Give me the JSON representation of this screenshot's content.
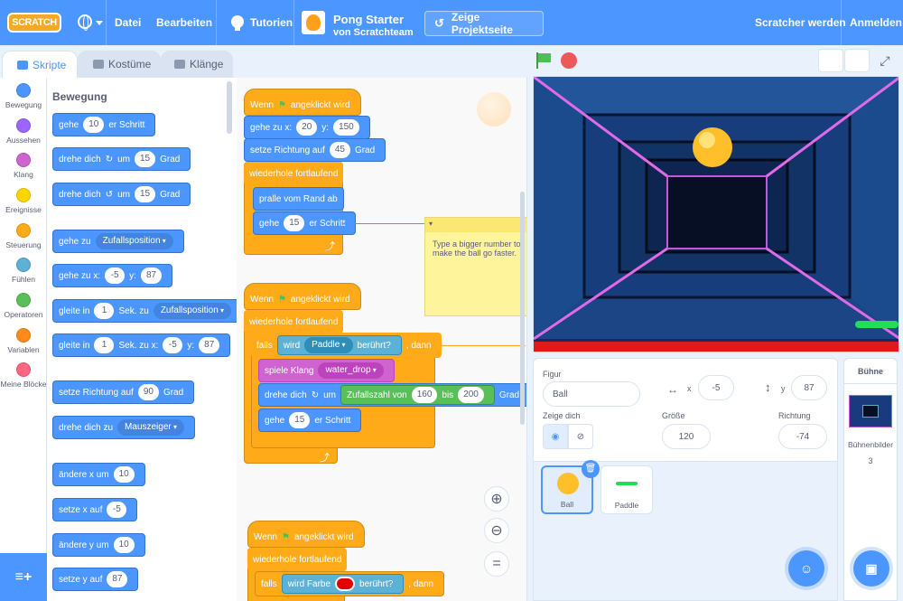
{
  "menubar": {
    "logo": "SCRATCH",
    "file": "Datei",
    "edit": "Bearbeiten",
    "tutorials": "Tutorien",
    "project_title": "Pong Starter",
    "project_by_prefix": "von",
    "project_author": "Scratchteam",
    "project_page": "Zeige Projektseite",
    "join": "Scratcher werden",
    "signin": "Anmelden"
  },
  "tabs": {
    "code": "Skripte",
    "costumes": "Kostüme",
    "sounds": "Klänge"
  },
  "categories": [
    {
      "label": "Bewegung",
      "color": "#4c97ff"
    },
    {
      "label": "Aussehen",
      "color": "#9966ff"
    },
    {
      "label": "Klang",
      "color": "#cf63cf"
    },
    {
      "label": "Ereignisse",
      "color": "#ffd500"
    },
    {
      "label": "Steuerung",
      "color": "#ffab19"
    },
    {
      "label": "Fühlen",
      "color": "#5cb1d6"
    },
    {
      "label": "Operatoren",
      "color": "#59c059"
    },
    {
      "label": "Variablen",
      "color": "#ff8c1a"
    },
    {
      "label": "Meine Blöcke",
      "color": "#ff6680"
    }
  ],
  "palette": {
    "title": "Bewegung",
    "move": {
      "a": "gehe",
      "v": "10",
      "b": "er Schritt"
    },
    "turn_right": {
      "a": "drehe dich",
      "b": "um",
      "v": "15",
      "c": "Grad"
    },
    "turn_left": {
      "a": "drehe dich",
      "b": "um",
      "v": "15",
      "c": "Grad"
    },
    "goto": {
      "a": "gehe zu",
      "d": "Zufallsposition"
    },
    "goto_xy": {
      "a": "gehe zu x:",
      "x": "-5",
      "b": "y:",
      "y": "87"
    },
    "glide": {
      "a": "gleite in",
      "v": "1",
      "b": "Sek. zu",
      "d": "Zufallsposition"
    },
    "glide_xy": {
      "a": "gleite in",
      "v": "1",
      "b": "Sek. zu x:",
      "x": "-5",
      "c": "y:",
      "y": "87"
    },
    "point_dir": {
      "a": "setze Richtung auf",
      "v": "90",
      "b": "Grad"
    },
    "point_towards": {
      "a": "drehe dich zu",
      "d": "Mauszeiger"
    },
    "change_x": {
      "a": "ändere x um",
      "v": "10"
    },
    "set_x": {
      "a": "setze x auf",
      "v": "-5"
    },
    "change_y": {
      "a": "ändere y um",
      "v": "10"
    },
    "set_y": {
      "a": "setze y auf",
      "v": "87"
    }
  },
  "script1": {
    "hat": "Wenn",
    "hat2": "angeklickt wird",
    "goto_a": "gehe zu x:",
    "x": "20",
    "goto_b": "y:",
    "y": "150",
    "dir_a": "setze Richtung auf",
    "dir_v": "45",
    "dir_b": "Grad",
    "forever": "wiederhole fortlaufend",
    "bounce": "pralle vom Rand ab",
    "move_a": "gehe",
    "move_v": "15",
    "move_b": "er Schritt"
  },
  "note": "Type a bigger number to make the ball go faster.",
  "script2": {
    "hat": "Wenn",
    "hat2": "angeklickt wird",
    "forever": "wiederhole fortlaufend",
    "if_a": "falls",
    "touch_a": "wird",
    "touch_d": "Paddle",
    "touch_b": "berührt?",
    "if_b": ", dann",
    "sound_a": "spiele Klang",
    "sound_d": "water_drop",
    "turn_a": "drehe dich",
    "turn_b": "um",
    "rand_a": "Zufallszahl von",
    "rand_v1": "160",
    "rand_b": "bis",
    "rand_v2": "200",
    "turn_c": "Grad",
    "move_a": "gehe",
    "move_v": "15",
    "move_b": "er Schritt"
  },
  "script3": {
    "hat": "Wenn",
    "hat2": "angeklickt wird",
    "forever": "wiederhole fortlaufend",
    "if_a": "falls",
    "color_a": "wird Farbe",
    "color_b": "berührt?",
    "if_b": ", dann"
  },
  "sprite_info": {
    "sprite_label": "Figur",
    "sprite_name": "Ball",
    "x_label": "x",
    "x": "-5",
    "y_label": "y",
    "y": "87",
    "show_label": "Zeige dich",
    "size_label": "Größe",
    "size": "120",
    "direction_label": "Richtung",
    "direction": "-74"
  },
  "sprites": [
    {
      "name": "Ball"
    },
    {
      "name": "Paddle"
    }
  ],
  "stage_panel": {
    "title": "Bühne",
    "backdrops_label": "Bühnenbilder",
    "backdrops_count": "3"
  }
}
